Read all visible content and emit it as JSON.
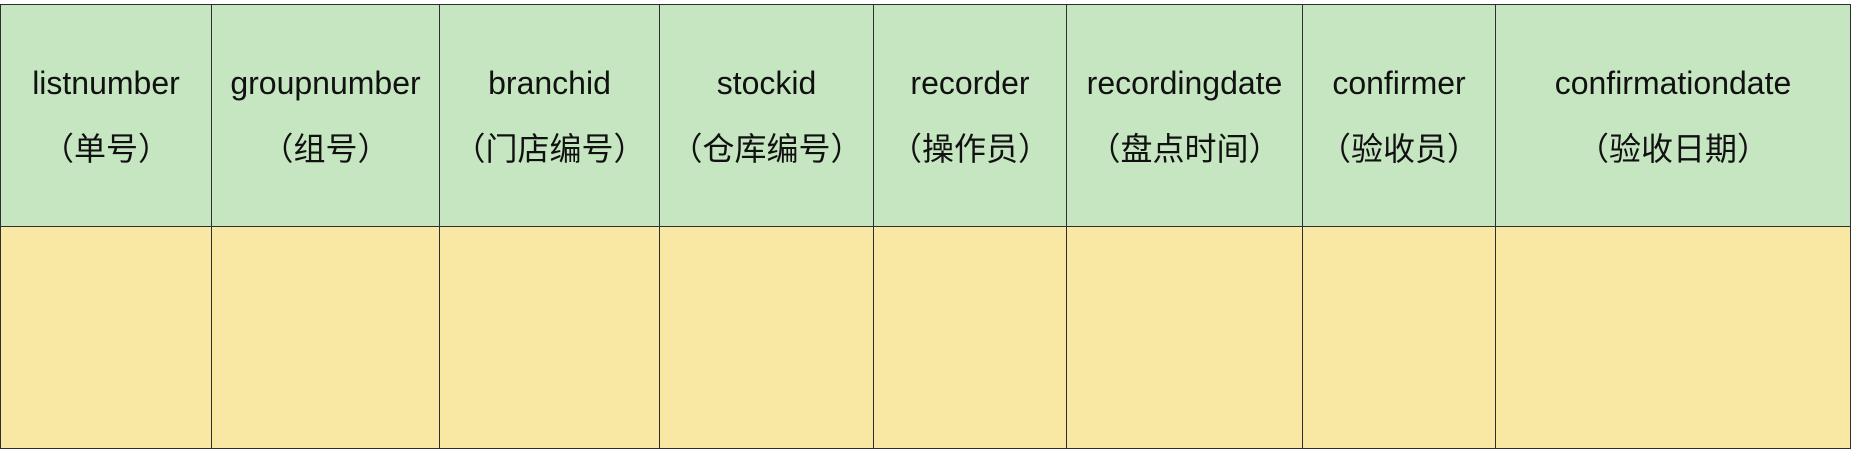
{
  "table": {
    "columns": [
      {
        "name": "listnumber",
        "desc": "（单号）"
      },
      {
        "name": "groupnumber",
        "desc": "（组号）"
      },
      {
        "name": "branchid",
        "desc": "（门店编号）"
      },
      {
        "name": "stockid",
        "desc": "（仓库编号）"
      },
      {
        "name": "recorder",
        "desc": "（操作员）"
      },
      {
        "name": "recordingdate",
        "desc": "（盘点时间）"
      },
      {
        "name": "confirmer",
        "desc": "（验收员）"
      },
      {
        "name": "confirmationdate",
        "desc": "（验收日期）"
      }
    ],
    "colors": {
      "header_bg": "#c6e6c1",
      "data_bg": "#f9e8a4",
      "border": "#2f2f2f"
    }
  }
}
